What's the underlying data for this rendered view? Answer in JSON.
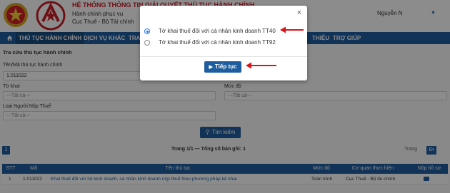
{
  "header": {
    "system_title": "HỆ THỐNG THÔNG TIN GIẢI QUYẾT THỦ TỤC HÀNH CHÍNH",
    "subtitle": "Hành chính phục vụ",
    "agency": "Cục Thuế - Bộ Tài chính",
    "user_name": "Nguyễn N"
  },
  "nav": {
    "items": [
      "THỦ TỤC HÀNH CHÍNH",
      "DỊCH VỤ KHÁC",
      "TRA",
      "THIỆU",
      "TRỢ GIÚP"
    ]
  },
  "search": {
    "section_title": "Tra cứu thủ tục hành chính",
    "procedure_label": "Tên/Mã thủ tục hành chính",
    "procedure_value": "1.011022",
    "form_label": "Tờ khai",
    "form_value": "---Tất cả---",
    "level_label": "Mức độ",
    "level_value": "---Tất cả---",
    "taxpayer_label": "Loại Người Nộp Thuế",
    "taxpayer_value": "---Tất cả---",
    "search_button": "Tìm kiếm"
  },
  "pager": {
    "page_button": "1",
    "info": "Trang 1/1 — Tổng số bản ghi: 1",
    "prev": "Trang",
    "next": "Đi"
  },
  "table": {
    "headers": [
      "STT",
      "Mã",
      "Tên thủ tục",
      "Mức độ",
      "Cơ quan thực hiện",
      "Nộp hồ sơ"
    ],
    "rows": [
      {
        "stt": "1",
        "code": "1.011022",
        "name": "Khai thuế đối với hộ kinh doanh, cá nhân kinh doanh nộp thuế theo phương pháp kê khai",
        "level": "Toàn trình",
        "agency": "Cục Thuế - Bộ tài chính"
      }
    ]
  },
  "modal": {
    "close": "×",
    "options": [
      {
        "label": "Tờ khai thuế đối với cá nhân kinh doanh TT40",
        "checked": true
      },
      {
        "label": "Tờ khai thuế đối với cá nhân kinh doanh TT92",
        "checked": false
      }
    ],
    "continue_button": "Tiếp tục"
  },
  "colors": {
    "primary": "#1f5e9e",
    "brand_red": "#c8202b",
    "annotation_arrow": "#d7161b"
  }
}
